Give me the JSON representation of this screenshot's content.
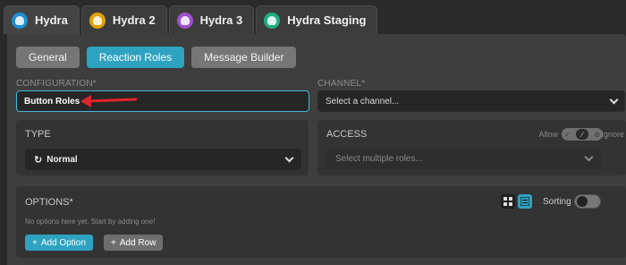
{
  "tabs": [
    {
      "label": "Hydra",
      "color": "#1d8fd1",
      "active": true
    },
    {
      "label": "Hydra 2",
      "color": "#e0a100",
      "active": false
    },
    {
      "label": "Hydra 3",
      "color": "#a04fd0",
      "active": false
    },
    {
      "label": "Hydra Staging",
      "color": "#1fae84",
      "active": false
    }
  ],
  "subtabs": [
    {
      "label": "General",
      "active": false
    },
    {
      "label": "Reaction Roles",
      "active": true
    },
    {
      "label": "Message Builder",
      "active": false
    }
  ],
  "form": {
    "configuration_label": "CONFIGURATION*",
    "configuration_value": "Button Roles",
    "channel_label": "CHANNEL*",
    "channel_placeholder": "Select a channel..."
  },
  "type": {
    "title": "TYPE",
    "value": "Normal",
    "icon": "rotate-icon"
  },
  "access": {
    "title": "ACCESS",
    "allow_label": "Allow",
    "ignore_label": "Ignore",
    "placeholder": "Select multiple roles..."
  },
  "options": {
    "title": "OPTIONS*",
    "empty_text": "No options here yet. Start by adding one!",
    "sorting_label": "Sorting",
    "add_option_label": "Add Option",
    "add_row_label": "Add Row"
  },
  "colors": {
    "accent": "#2ea3c1",
    "annotation_arrow": "#e0242b"
  }
}
